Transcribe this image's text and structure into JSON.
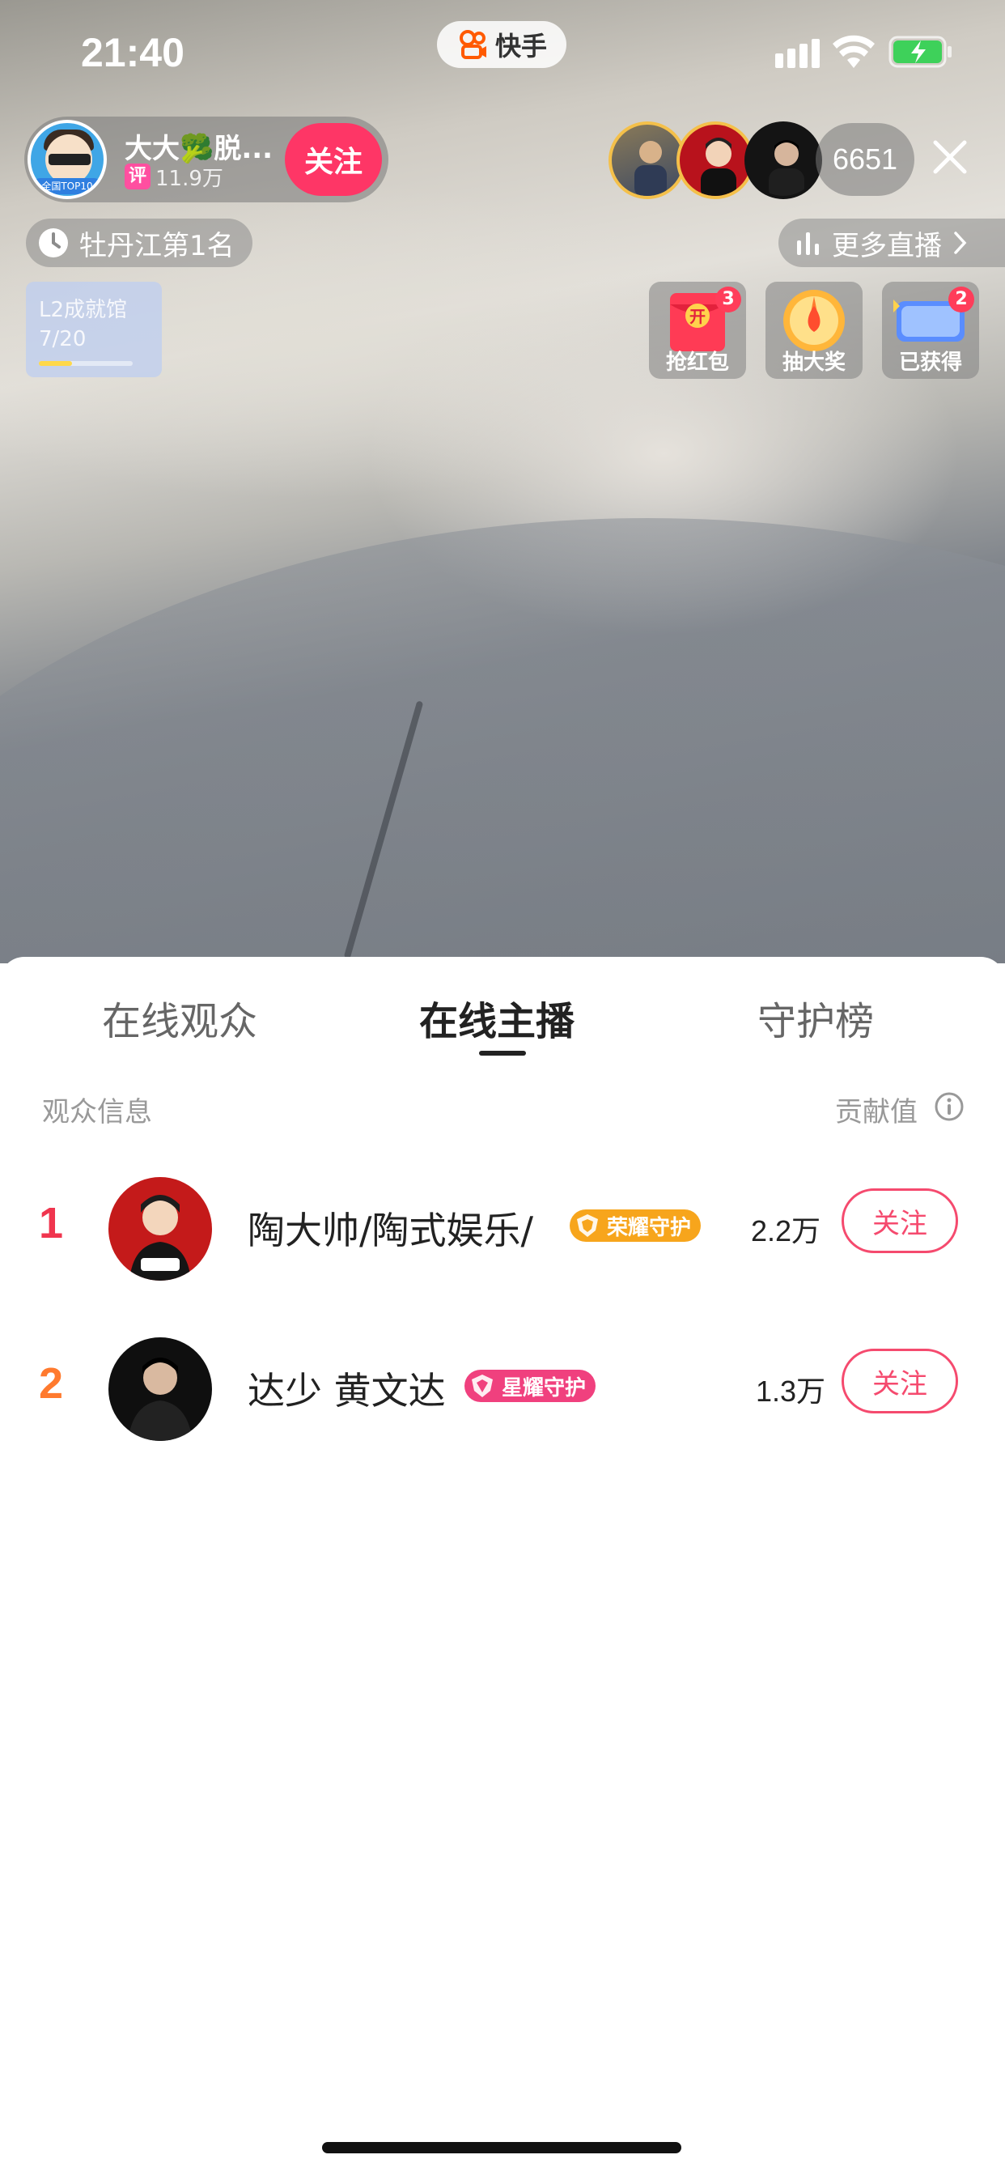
{
  "status_bar": {
    "time": "21:40",
    "app_name": "快手"
  },
  "streamer": {
    "name": "大大🥦脱...",
    "rating_badge": "评",
    "fans": "11.9万",
    "avatar_tag": "全国TOP10",
    "follow_label": "关注"
  },
  "viewers": {
    "count": "6651"
  },
  "rank_pill": {
    "label": "牡丹江第1名"
  },
  "more_live": {
    "label": "更多直播"
  },
  "level": {
    "title": "L2成就馆",
    "progress_text": "7/20",
    "progress": 0.35
  },
  "activities": [
    {
      "label": "抢红包",
      "badge": "3",
      "icon": "red-envelope-icon"
    },
    {
      "label": "抽大奖",
      "badge": "",
      "icon": "lucky-wheel-icon"
    },
    {
      "label": "已获得",
      "badge": "2",
      "icon": "popularity-card-icon"
    }
  ],
  "sheet": {
    "tabs": [
      "在线观众",
      "在线主播",
      "守护榜"
    ],
    "active_tab": 1,
    "header_left": "观众信息",
    "header_right": "贡献值",
    "rows": [
      {
        "rank": "1",
        "name": "陶大帅/陶式娱乐/",
        "guard": "荣耀守护",
        "score": "2.2万",
        "follow": "关注",
        "rank_color": "#f0354e",
        "guard_color": "#f7a51c"
      },
      {
        "rank": "2",
        "name": "达少 黄文达",
        "guard": "星耀守护",
        "score": "1.3万",
        "follow": "关注",
        "rank_color": "#ff7a2e",
        "guard_color": "#f0407e"
      }
    ]
  }
}
